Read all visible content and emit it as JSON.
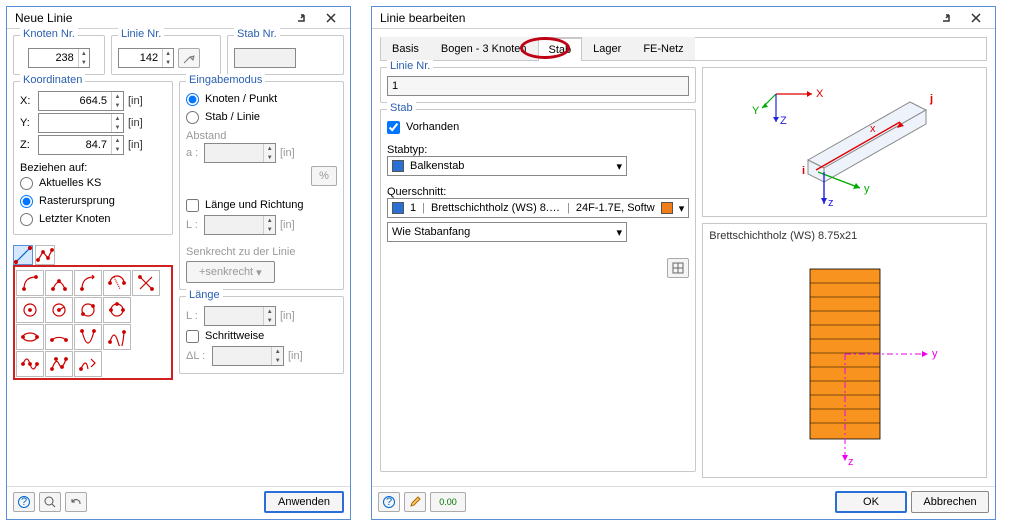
{
  "left": {
    "title": "Neue Linie",
    "knoten_group": "Knoten Nr.",
    "knoten_val": "238",
    "linie_group": "Linie Nr.",
    "linie_val": "142",
    "stab_group": "Stab Nr.",
    "stab_val": "",
    "koord_group": "Koordinaten",
    "x_lbl": "X:",
    "y_lbl": "Y:",
    "z_lbl": "Z:",
    "x_val": "664.5",
    "y_val": "",
    "z_val": "84.7",
    "unit": "[in]",
    "beziehen": "Beziehen auf:",
    "r1": "Aktuelles KS",
    "r2": "Rasterursprung",
    "r3": "Letzter Knoten",
    "eingabe_group": "Eingabemodus",
    "e1": "Knoten / Punkt",
    "e2": "Stab / Linie",
    "abstand": "Abstand",
    "a_lbl": "a :",
    "percent": "%",
    "laenge_chk": "Länge und Richtung",
    "l_lbl": "L :",
    "senkrecht": "Senkrecht zu der Linie",
    "senkrecht_btn": "+senkrecht",
    "laenge_group": "Länge",
    "schrittweise": "Schrittweise",
    "dl_lbl": "ΔL :",
    "apply": "Anwenden"
  },
  "right": {
    "title": "Linie bearbeiten",
    "tabs": [
      "Basis",
      "Bogen - 3 Knoten",
      "Stab",
      "Lager",
      "FE-Netz"
    ],
    "linie_group": "Linie Nr.",
    "linie_val": "1",
    "stab_group": "Stab",
    "vorhanden": "Vorhanden",
    "stabtyp_lbl": "Stabtyp:",
    "stabtyp_val": "Balkenstab",
    "querschnitt_lbl": "Querschnitt:",
    "qs_num": "1",
    "qs_name": "Brettschichtholz (WS) 8.75x21",
    "qs_mat": "24F-1.7E, Softw",
    "wie": "Wie Stabanfang",
    "preview_title": "Brettschichtholz (WS) 8.75x21",
    "axes": {
      "X": "X",
      "Y": "Y",
      "Z": "Z",
      "x": "x",
      "y": "y",
      "z": "z",
      "i": "i",
      "j": "j"
    },
    "ok": "OK",
    "cancel": "Abbrechen",
    "digits": "0.00"
  }
}
